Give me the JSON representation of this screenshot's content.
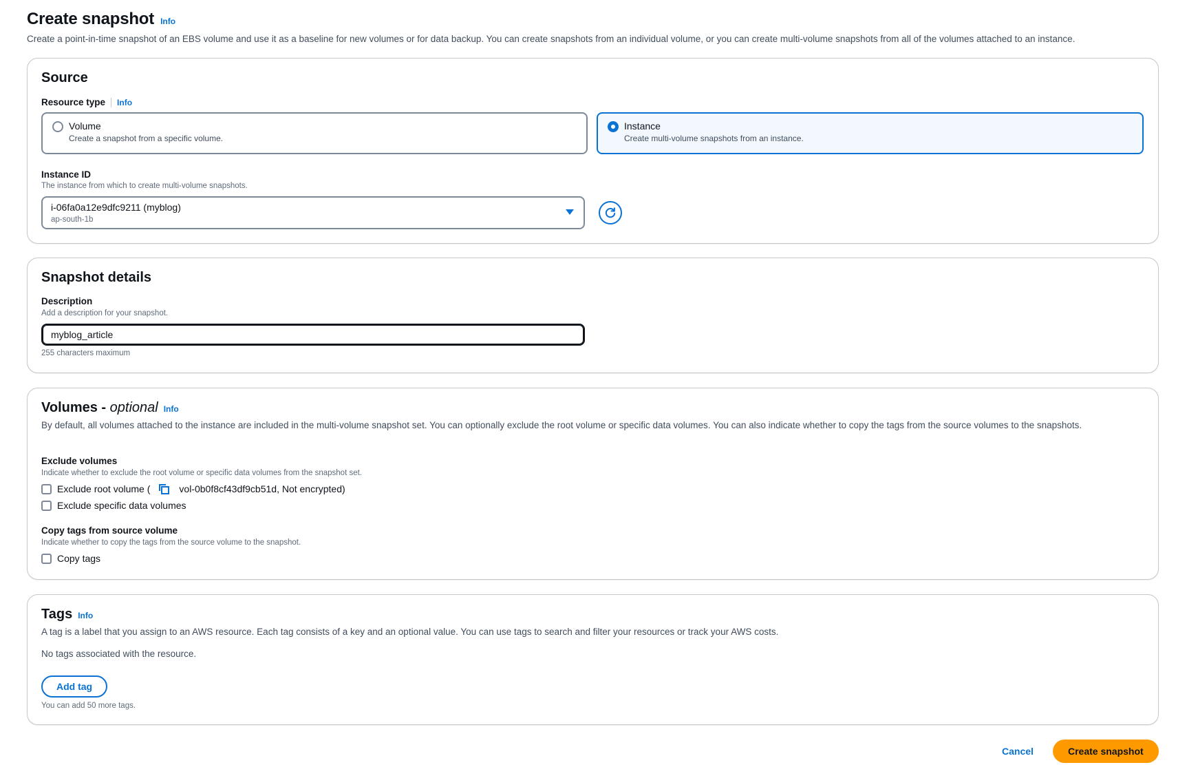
{
  "header": {
    "title": "Create snapshot",
    "info": "Info",
    "description": "Create a point-in-time snapshot of an EBS volume and use it as a baseline for new volumes or for data backup. You can create snapshots from an individual volume, or you can create multi-volume snapshots from all of the volumes attached to an instance."
  },
  "source": {
    "title": "Source",
    "resource_type_label": "Resource type",
    "info": "Info",
    "options": [
      {
        "label": "Volume",
        "description": "Create a snapshot from a specific volume.",
        "selected": false
      },
      {
        "label": "Instance",
        "description": "Create multi-volume snapshots from an instance.",
        "selected": true
      }
    ],
    "instance_id_label": "Instance ID",
    "instance_id_desc": "The instance from which to create multi-volume snapshots.",
    "instance_value": "i-06fa0a12e9dfc9211 (myblog)",
    "instance_zone": "ap-south-1b"
  },
  "snapshot_details": {
    "title": "Snapshot details",
    "description_label": "Description",
    "description_desc": "Add a description for your snapshot.",
    "description_value": "myblog_article",
    "description_hint": "255 characters maximum"
  },
  "volumes": {
    "title": "Volumes - ",
    "title_optional": "optional",
    "info": "Info",
    "description": "By default, all volumes attached to the instance are included in the multi-volume snapshot set. You can optionally exclude the root volume or specific data volumes. You can also indicate whether to copy the tags from the source volumes to the snapshots.",
    "exclude_label": "Exclude volumes",
    "exclude_desc": "Indicate whether to exclude the root volume or specific data volumes from the snapshot set.",
    "exclude_root_prefix": "Exclude root volume (",
    "exclude_root_volume": "vol-0b0f8cf43df9cb51d, Not encrypted)",
    "exclude_specific": "Exclude specific data volumes",
    "copy_tags_label": "Copy tags from source volume",
    "copy_tags_desc": "Indicate whether to copy the tags from the source volume to the snapshot.",
    "copy_tags": "Copy tags"
  },
  "tags": {
    "title": "Tags",
    "info": "Info",
    "description": "A tag is a label that you assign to an AWS resource. Each tag consists of a key and an optional value. You can use tags to search and filter your resources or track your AWS costs.",
    "empty": "No tags associated with the resource.",
    "add_button": "Add tag",
    "limit_hint": "You can add 50 more tags."
  },
  "footer": {
    "cancel": "Cancel",
    "create": "Create snapshot"
  },
  "colors": {
    "accent": "#0972d3",
    "primary_button": "#ff9900",
    "selected_tile_bg": "#f2f8fd"
  }
}
